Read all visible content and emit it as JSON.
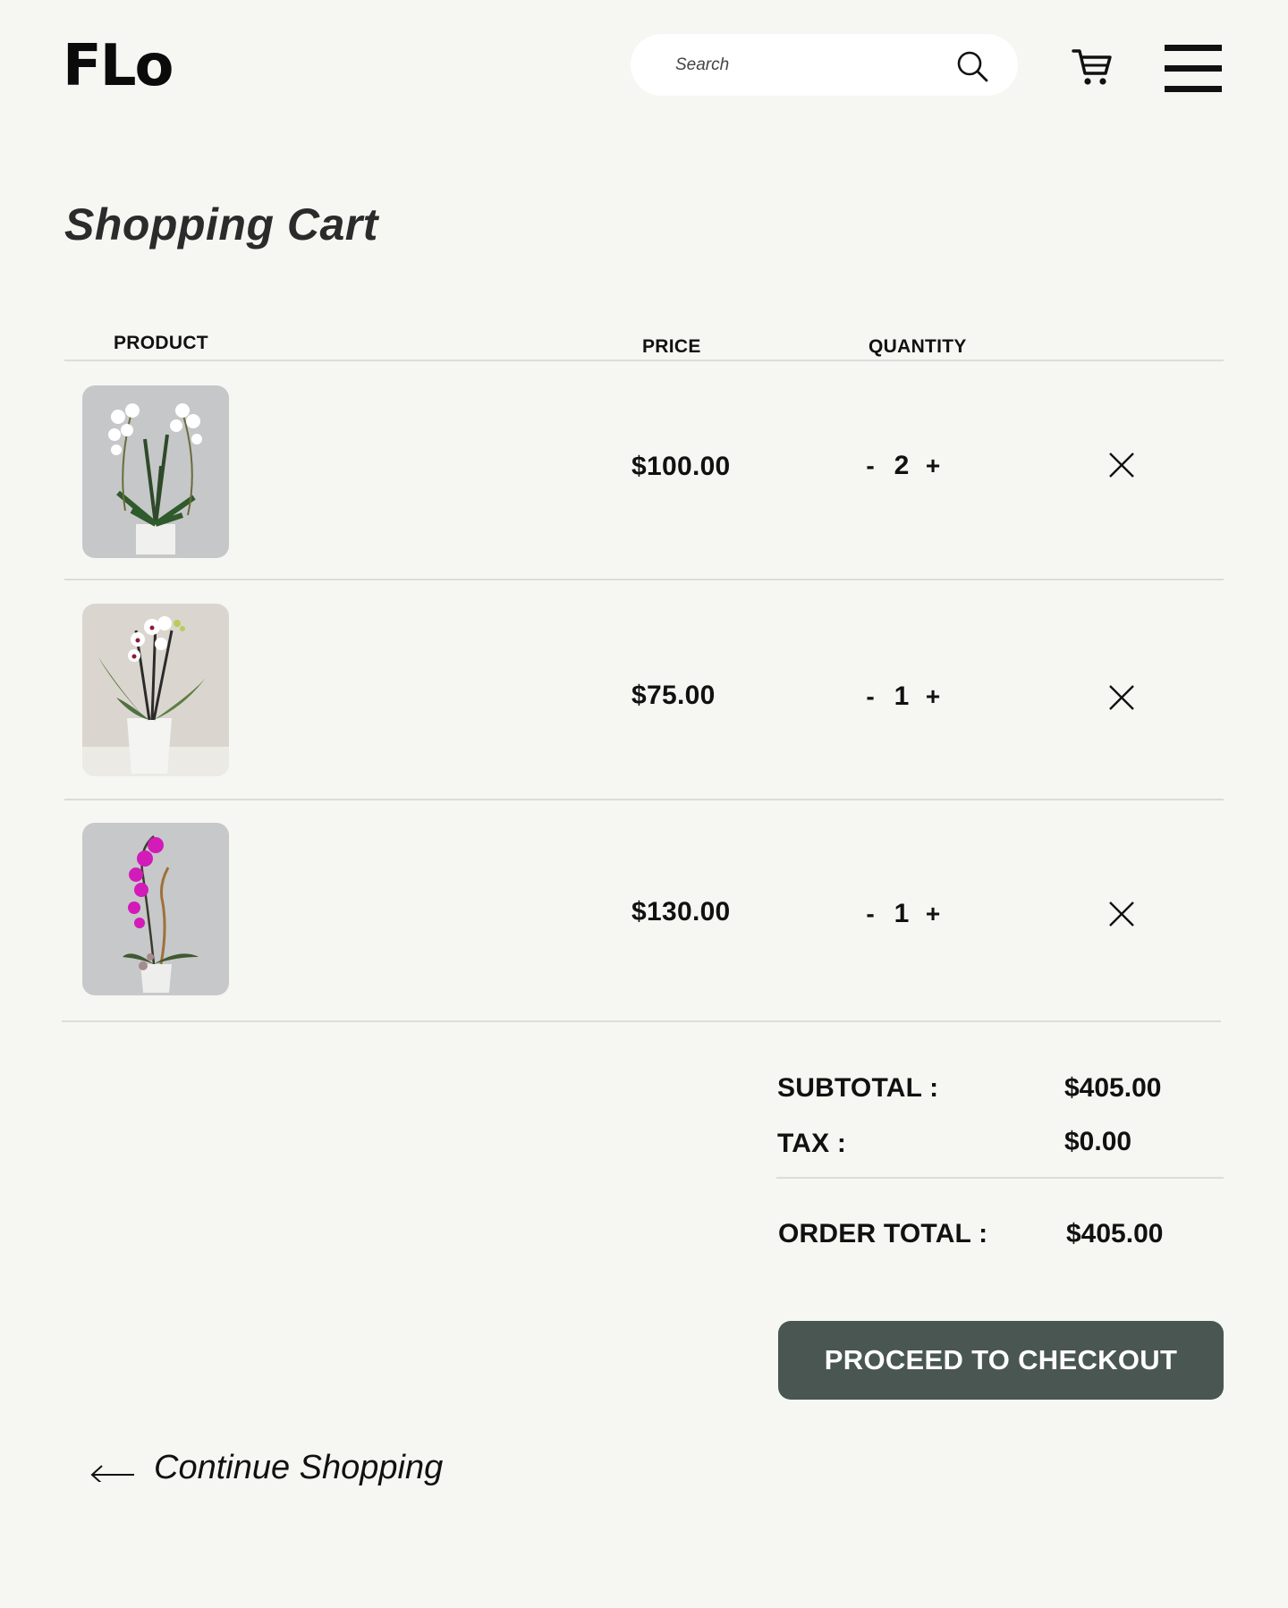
{
  "header": {
    "logo": "FLo",
    "search_placeholder": "Search",
    "icons": [
      "search-icon",
      "cart-icon",
      "hamburger-menu-icon"
    ]
  },
  "page": {
    "title": "Shopping Cart"
  },
  "table": {
    "headers": {
      "product": "PRODUCT",
      "price": "PRICE",
      "quantity": "QUANTITY"
    },
    "items": [
      {
        "image": "white-orchid-arrangement",
        "price": "$100.00",
        "quantity": "2",
        "minus": "-",
        "plus": "+"
      },
      {
        "image": "white-orchid-potted",
        "price": "$75.00",
        "quantity": "1",
        "minus": "-",
        "plus": "+"
      },
      {
        "image": "magenta-orchid-arrangement",
        "price": "$130.00",
        "quantity": "1",
        "minus": "-",
        "plus": "+"
      }
    ]
  },
  "summary": {
    "subtotal_label": "SUBTOTAL :",
    "subtotal_value": "$405.00",
    "tax_label": "TAX :",
    "tax_value": "$0.00",
    "total_label": "ORDER TOTAL :",
    "total_value": "$405.00"
  },
  "actions": {
    "checkout_label": "PROCEED TO CHECKOUT",
    "continue_label": "Continue Shopping"
  },
  "colors": {
    "background": "#f6f7f2",
    "checkout_button": "#4a5651",
    "divider": "#dcdcdc"
  }
}
